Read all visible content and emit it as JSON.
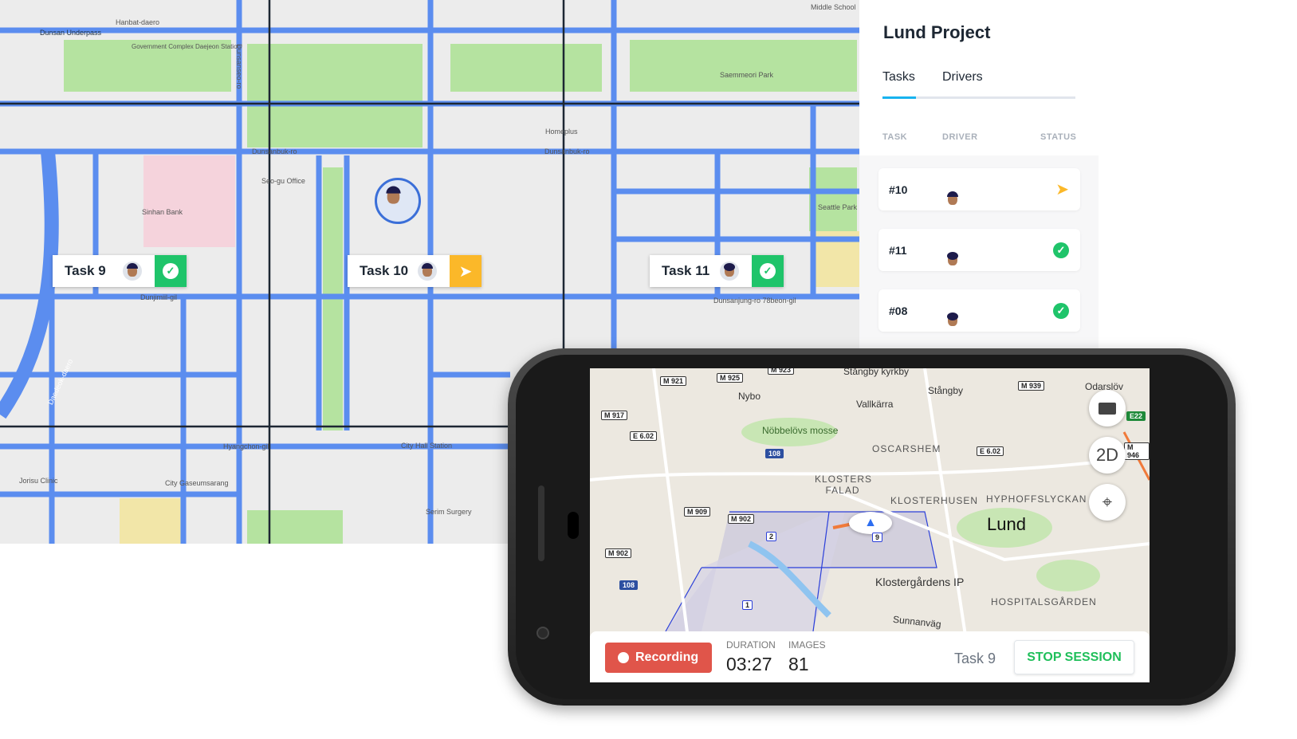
{
  "map": {
    "labels": [
      "Hanbat-daero",
      "Dunsan Underpass",
      "Government Complex Daejeon Station",
      "Saemmeori Park",
      "Dunsanbuk-ro",
      "Homeplus",
      "Seo-gu Office",
      "Sinhan Bank",
      "Seattle Park",
      "Dunjimiil-gil",
      "Dunsanjung-ro 78beon-gil",
      "Hyangchon-gil",
      "City Hall Station",
      "City Gaseumsarang",
      "Serim Surgery",
      "Jorisu Clinic",
      "Middle School",
      "Dunsanseo-ro",
      "Daedeok-daero",
      "Dunsanbuk-ro"
    ],
    "markers": [
      {
        "label": "Task 9",
        "status": "done"
      },
      {
        "label": "Task 10",
        "status": "in-progress"
      },
      {
        "label": "Task 11",
        "status": "done"
      }
    ],
    "colors": {
      "road": "#5b8def",
      "park": "#b5e3a0",
      "grid": "#1d2733",
      "done": "#1fc46a",
      "progress": "#fbb829"
    }
  },
  "panel": {
    "title": "Lund Project",
    "tabs": [
      "Tasks",
      "Drivers"
    ],
    "active_tab": "Tasks",
    "columns": [
      "TASK",
      "DRIVER",
      "STATUS"
    ],
    "rows": [
      {
        "task": "#10",
        "status": "in-progress"
      },
      {
        "task": "#11",
        "status": "done"
      },
      {
        "task": "#08",
        "status": "done"
      }
    ]
  },
  "phone": {
    "places": [
      "Stångby kyrkby",
      "Nybo",
      "Vallkärra",
      "Stångby",
      "Odarslöv",
      "Nöbbelövs mosse",
      "OSCARSHEM",
      "KLOSTERS FALAD",
      "KLOSTERHUSEN",
      "HYPHOFFSLYCKAN",
      "Lund",
      "Klostergårdens IP",
      "HOSPITALSGÅRDEN",
      "Sunnanväg"
    ],
    "shields": [
      "M 921",
      "M 925",
      "M 923",
      "M 917",
      "E 6.02",
      "108",
      "M 909",
      "M 902",
      "M 902",
      "108",
      "M 939",
      "E22",
      "E 6.02",
      "M 946",
      "2",
      "9",
      "1"
    ],
    "buttons": {
      "camera": "camera-icon",
      "mode": "2D",
      "locate": "locate-icon"
    },
    "session": {
      "recording_label": "Recording",
      "duration_label": "DURATION",
      "duration": "03:27",
      "images_label": "IMAGES",
      "images": "81",
      "task": "Task 9",
      "stop_label": "STOP SESSION"
    }
  }
}
